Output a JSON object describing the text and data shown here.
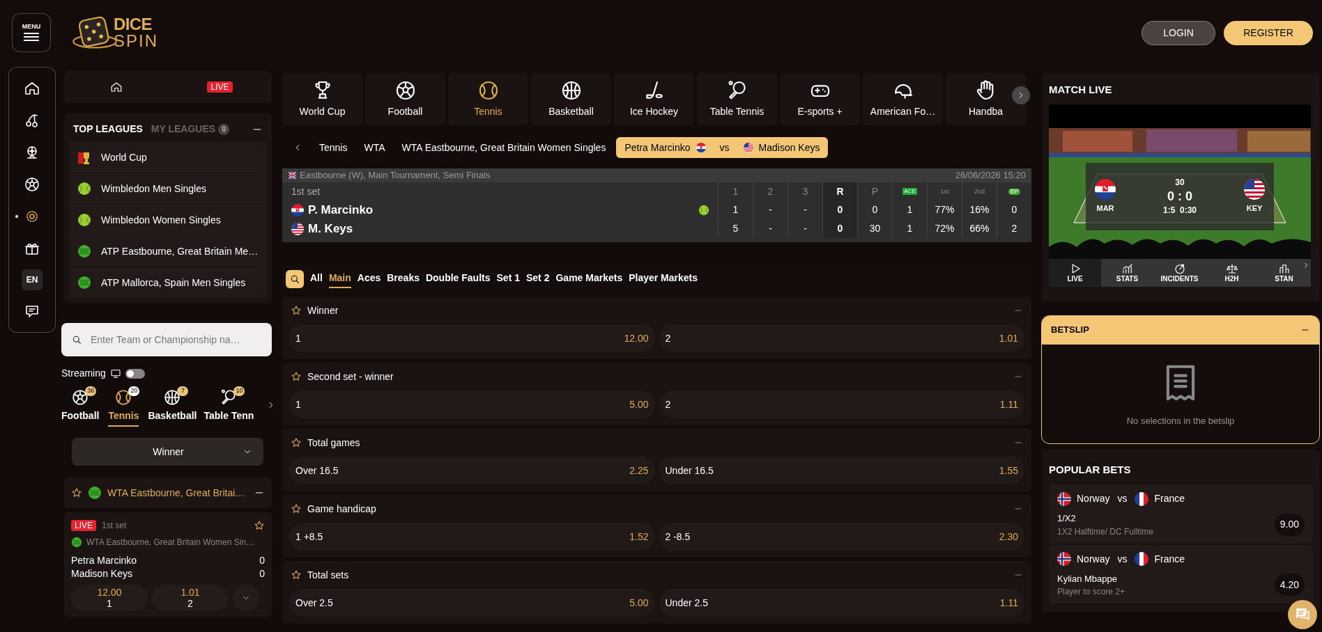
{
  "header": {
    "menu_label": "MENU",
    "logo_top": "DICE",
    "logo_bottom": "SPIN",
    "buttons": [
      {
        "label": "LOGIN",
        "kind": "secondary"
      },
      {
        "label": "REGISTER",
        "kind": "primary"
      }
    ]
  },
  "rail": [
    {
      "kind": "home",
      "selected": false
    },
    {
      "kind": "slots",
      "selected": false
    },
    {
      "kind": "casino",
      "selected": false
    },
    {
      "kind": "football",
      "selected": false
    },
    {
      "kind": "live",
      "selected": true
    },
    {
      "kind": "promotions",
      "selected": false
    },
    {
      "kind": "language",
      "label": "EN",
      "selected": false
    },
    {
      "kind": "support",
      "selected": false
    }
  ],
  "quick_bar": {
    "live_badge": "LIVE"
  },
  "leagues": {
    "tabs": [
      {
        "label": "TOP LEAGUES",
        "selected": true
      },
      {
        "label": "MY LEAGUES",
        "count": "0",
        "selected": false
      }
    ],
    "items": [
      {
        "name": "World Cup",
        "kind": "trophy"
      },
      {
        "name": "Wimbledon Men Singles",
        "kind": "ball"
      },
      {
        "name": "Wimbledon Women Singles",
        "kind": "ball"
      },
      {
        "name": "ATP Eastbourne, Great Britain Me…",
        "kind": "atp"
      },
      {
        "name": "ATP Mallorca, Spain Men Singles",
        "kind": "atp"
      }
    ]
  },
  "search": {
    "placeholder": "Enter Team or Championship na…"
  },
  "streaming": {
    "label": "Streaming",
    "on": false
  },
  "sport_tabs": [
    {
      "name": "Football",
      "count": "36",
      "kind": "football",
      "selected": false
    },
    {
      "name": "Tennis",
      "count": "20",
      "kind": "tennis",
      "selected": true
    },
    {
      "name": "Basketball",
      "count": "7",
      "kind": "basketball",
      "selected": false
    },
    {
      "name": "Table Tenn",
      "count": "10",
      "kind": "table_tennis",
      "selected": false
    }
  ],
  "market_select": {
    "value": "Winner"
  },
  "league_group": {
    "name": "WTA Eastbourne, Great Britai…"
  },
  "match_card": {
    "live_badge": "LIVE",
    "period": "1st set",
    "league": "WTA Eastbourne, Great Britain Women Sin…",
    "players": [
      {
        "name": "Petra Marcinko",
        "score": "0"
      },
      {
        "name": "Madison Keys",
        "score": "0"
      }
    ],
    "odds": [
      {
        "price": "12.00",
        "label": "1"
      },
      {
        "price": "1.01",
        "label": "2"
      }
    ]
  },
  "sport_nav": [
    {
      "label": "World Cup",
      "kind": "world_cup",
      "selected": false
    },
    {
      "label": "Football",
      "kind": "football",
      "selected": false
    },
    {
      "label": "Tennis",
      "kind": "tennis",
      "selected": true
    },
    {
      "label": "Basketball",
      "kind": "basketball",
      "selected": false
    },
    {
      "label": "Ice Hockey",
      "kind": "ice_hockey",
      "selected": false
    },
    {
      "label": "Table Tennis",
      "kind": "table_tennis",
      "selected": false
    },
    {
      "label": "E-sports +",
      "kind": "esports",
      "selected": false
    },
    {
      "label": "American Fo…",
      "kind": "american_football",
      "selected": false
    },
    {
      "label": "Handba",
      "kind": "handball",
      "selected": false
    }
  ],
  "breadcrumb": {
    "items": [
      "Tennis",
      "WTA",
      "WTA Eastbourne, Great Britain Women Singles"
    ],
    "current": {
      "home": {
        "name": "Petra Marcinko",
        "kind": "hr"
      },
      "vs": "vs",
      "away": {
        "name": "Madison Keys",
        "kind": "us"
      }
    }
  },
  "scoreboard": {
    "title_flag": {
      "kind": "gb"
    },
    "title": "Eastbourne (W), Main Tournament, Semi Finals",
    "datetime": "26/06/2026 15:20",
    "period": "1st set",
    "columns": [
      {
        "label": "1",
        "kind": "text"
      },
      {
        "label": "2",
        "kind": "text"
      },
      {
        "label": "3",
        "kind": "text"
      },
      {
        "label": "R",
        "kind": "total"
      },
      {
        "label": "P",
        "kind": "text"
      },
      {
        "label": "ACE",
        "kind": "badge"
      },
      {
        "label": "1st",
        "kind": "pct"
      },
      {
        "label": "2nd",
        "kind": "pct"
      },
      {
        "label": "BP",
        "kind": "bp"
      }
    ],
    "rows": [
      {
        "name": "P. Marcinko",
        "kind": "hr",
        "serving": true,
        "cells": [
          "1",
          "-",
          "-",
          "0",
          "0",
          "1",
          "77%",
          "16%",
          "0"
        ]
      },
      {
        "name": "M. Keys",
        "kind": "us",
        "serving": false,
        "cells": [
          "5",
          "-",
          "-",
          "0",
          "30",
          "1",
          "72%",
          "66%",
          "2"
        ]
      }
    ]
  },
  "market_tabs": [
    {
      "label": "All",
      "selected": false
    },
    {
      "label": "Main",
      "selected": true
    },
    {
      "label": "Aces",
      "selected": false
    },
    {
      "label": "Breaks",
      "selected": false
    },
    {
      "label": "Double Faults",
      "selected": false
    },
    {
      "label": "Set 1",
      "selected": false
    },
    {
      "label": "Set 2",
      "selected": false
    },
    {
      "label": "Game Markets",
      "selected": false
    },
    {
      "label": "Player Markets",
      "selected": false
    }
  ],
  "markets": [
    {
      "title": "Winner",
      "outcomes": [
        {
          "label": "1",
          "price": "12.00"
        },
        {
          "label": "2",
          "price": "1.01"
        }
      ]
    },
    {
      "title": "Second set - winner",
      "outcomes": [
        {
          "label": "1",
          "price": "5.00"
        },
        {
          "label": "2",
          "price": "1.11"
        }
      ]
    },
    {
      "title": "Total games",
      "outcomes": [
        {
          "label": "Over 16.5",
          "price": "2.25"
        },
        {
          "label": "Under 16.5",
          "price": "1.55"
        }
      ]
    },
    {
      "title": "Game handicap",
      "outcomes": [
        {
          "label": "1 +8.5",
          "price": "1.52"
        },
        {
          "label": "2 -8.5",
          "price": "2.30"
        }
      ]
    },
    {
      "title": "Total sets",
      "outcomes": [
        {
          "label": "Over 2.5",
          "price": "5.00"
        },
        {
          "label": "Under 2.5",
          "price": "1.11"
        }
      ]
    }
  ],
  "match_live": {
    "title": "MATCH LIVE",
    "tracker": {
      "point": "30",
      "score": "0 : 0",
      "detail": "1:5  0:30",
      "home": {
        "code": "MAR",
        "kind": "hr"
      },
      "away": {
        "code": "KEY",
        "kind": "us"
      }
    },
    "tabs": [
      {
        "label": "LIVE",
        "kind": "play",
        "selected": true
      },
      {
        "label": "STATS",
        "kind": "stats",
        "selected": false
      },
      {
        "label": "INCIDENTS",
        "kind": "incidents",
        "selected": false
      },
      {
        "label": "H2H",
        "kind": "h2h",
        "selected": false
      },
      {
        "label": "STAN",
        "kind": "standings",
        "selected": false
      }
    ]
  },
  "betslip": {
    "title": "BETSLIP",
    "empty_text": "No selections in the betslip"
  },
  "popular_bets": {
    "title": "POPULAR BETS",
    "items": [
      {
        "home": {
          "name": "Norway",
          "kind": "no"
        },
        "vs": "vs",
        "away": {
          "name": "France",
          "kind": "fr"
        },
        "market": "1/X2",
        "selection": "1X2 Halftime/ DC Fulltime",
        "price": "9.00"
      },
      {
        "home": {
          "name": "Norway",
          "kind": "no"
        },
        "vs": "vs",
        "away": {
          "name": "France",
          "kind": "fr"
        },
        "market": "Kylian Mbappe",
        "selection": "Player to score 2+",
        "price": "4.20"
      }
    ]
  }
}
